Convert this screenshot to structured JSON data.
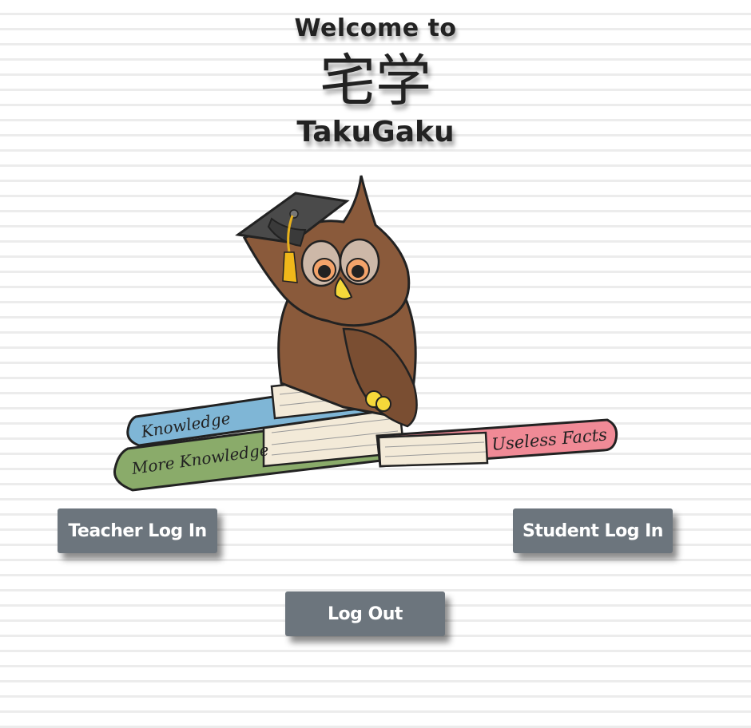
{
  "header": {
    "welcome": "Welcome to",
    "kanji": "宅学",
    "brand": "TakuGaku"
  },
  "mascot": {
    "books": {
      "blue": "Knowledge",
      "green": "More Knowledge",
      "pink": "Useless Facts"
    }
  },
  "buttons": {
    "teacher": "Teacher Log In",
    "student": "Student Log In",
    "logout": "Log Out"
  },
  "colors": {
    "button_bg": "#6c757d",
    "owl_brown": "#8a5a3b",
    "book_blue": "#7fb6d6",
    "book_green": "#8aab6a",
    "book_pink": "#f08a96"
  }
}
